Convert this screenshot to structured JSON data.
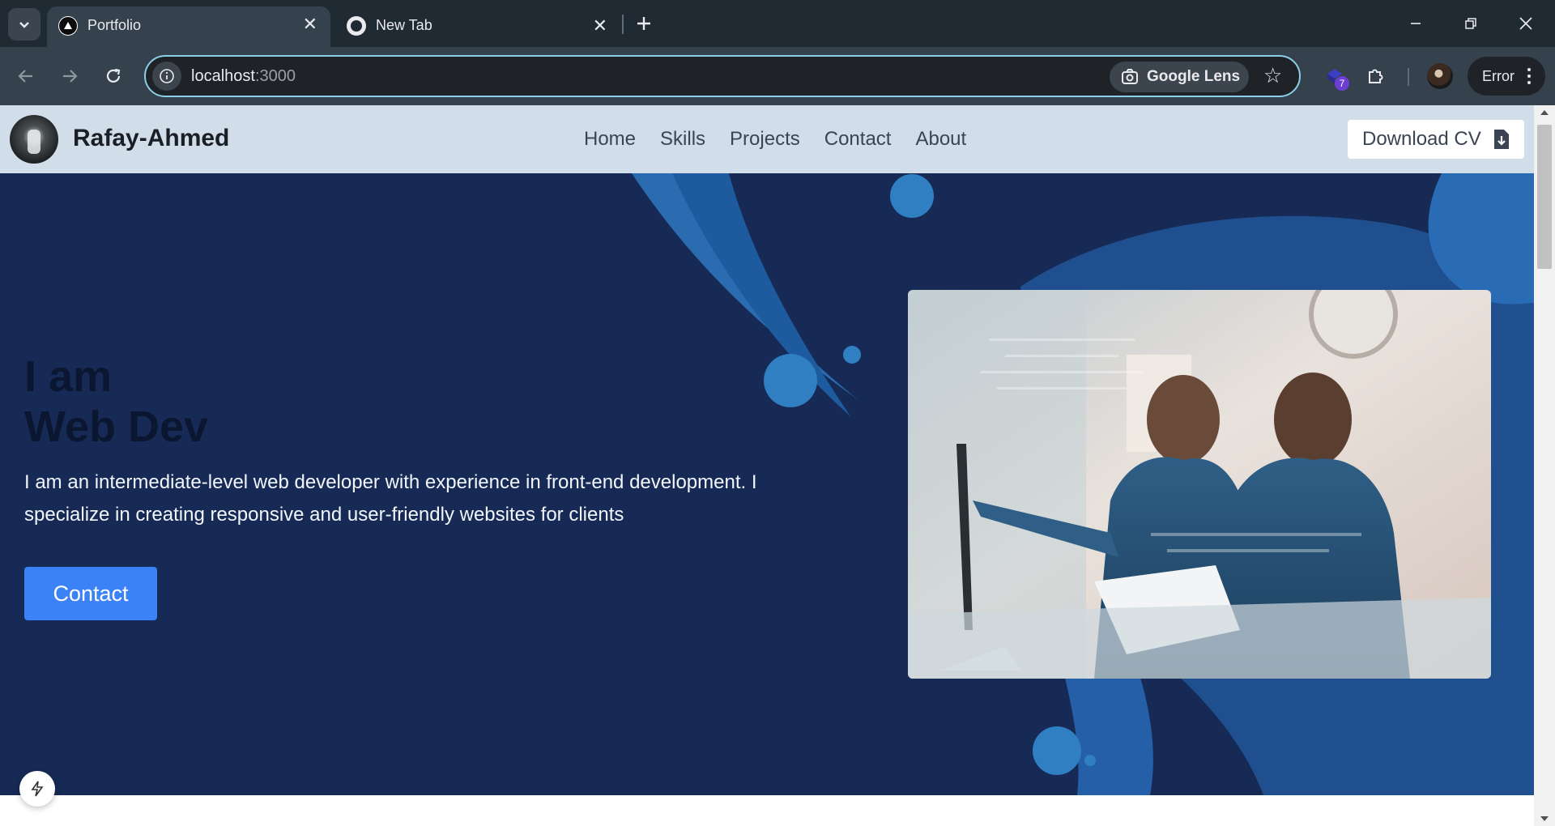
{
  "browser": {
    "tabs": [
      {
        "title": "Portfolio",
        "active": true
      },
      {
        "title": "New Tab",
        "active": false
      }
    ],
    "url_host": "localhost",
    "url_port": ":3000",
    "lens_label": "Google Lens",
    "extension_badge": "7",
    "profile_status": "Error"
  },
  "site": {
    "brand": "Rafay-Ahmed",
    "nav": [
      "Home",
      "Skills",
      "Projects",
      "Contact",
      "About"
    ],
    "download_cv": "Download CV"
  },
  "hero": {
    "title_line1": "I am",
    "title_line2": "Web Dev",
    "description": "I am an intermediate-level web developer with experience in front-end development. I specialize in creating responsive and user-friendly websites for clients",
    "contact_button": "Contact"
  },
  "colors": {
    "hero_bg": "#162a55",
    "accent_blue": "#3b82f6",
    "navbar_bg": "#d1dde9",
    "chrome_dark": "#202a33"
  }
}
